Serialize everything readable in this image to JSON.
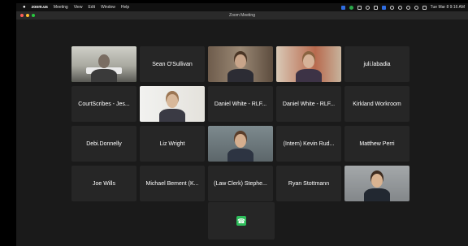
{
  "menubar": {
    "apple": "",
    "items": [
      "zoom.us",
      "Meeting",
      "View",
      "Edit",
      "Window",
      "Help"
    ],
    "clock": "Tue Mar 8  9:16 AM"
  },
  "window": {
    "title": "Zoom Meeting"
  },
  "participants": [
    {
      "name": "",
      "video": "office",
      "speaking": true
    },
    {
      "name": "Sean O'Sullivan"
    },
    {
      "name": "",
      "video": "woman-room"
    },
    {
      "name": "",
      "video": "woman-art"
    },
    {
      "name": "juli.labadia"
    },
    {
      "name": "CourtScribes - Jes..."
    },
    {
      "name": "",
      "video": "woman-bright"
    },
    {
      "name": "Daniel White - RLF..."
    },
    {
      "name": "Daniel White - RLF..."
    },
    {
      "name": "Kirkland Workroom"
    },
    {
      "name": "Debi.Donnelly"
    },
    {
      "name": "Liz Wright"
    },
    {
      "name": "",
      "video": "man-portrait"
    },
    {
      "name": "(Intern) Kevin Rud..."
    },
    {
      "name": "Matthew Perri"
    },
    {
      "name": "Joe Wills"
    },
    {
      "name": "Michael Bement (K..."
    },
    {
      "name": "(Law Clerk) Stephe..."
    },
    {
      "name": "Ryan Stottmann"
    },
    {
      "name": "",
      "video": "man-portrait-2"
    }
  ],
  "call_button": {
    "icon": "phone-icon"
  },
  "colors": {
    "speaking": "#7ed957",
    "tile": "#262626",
    "call": "#2dbd5a"
  }
}
